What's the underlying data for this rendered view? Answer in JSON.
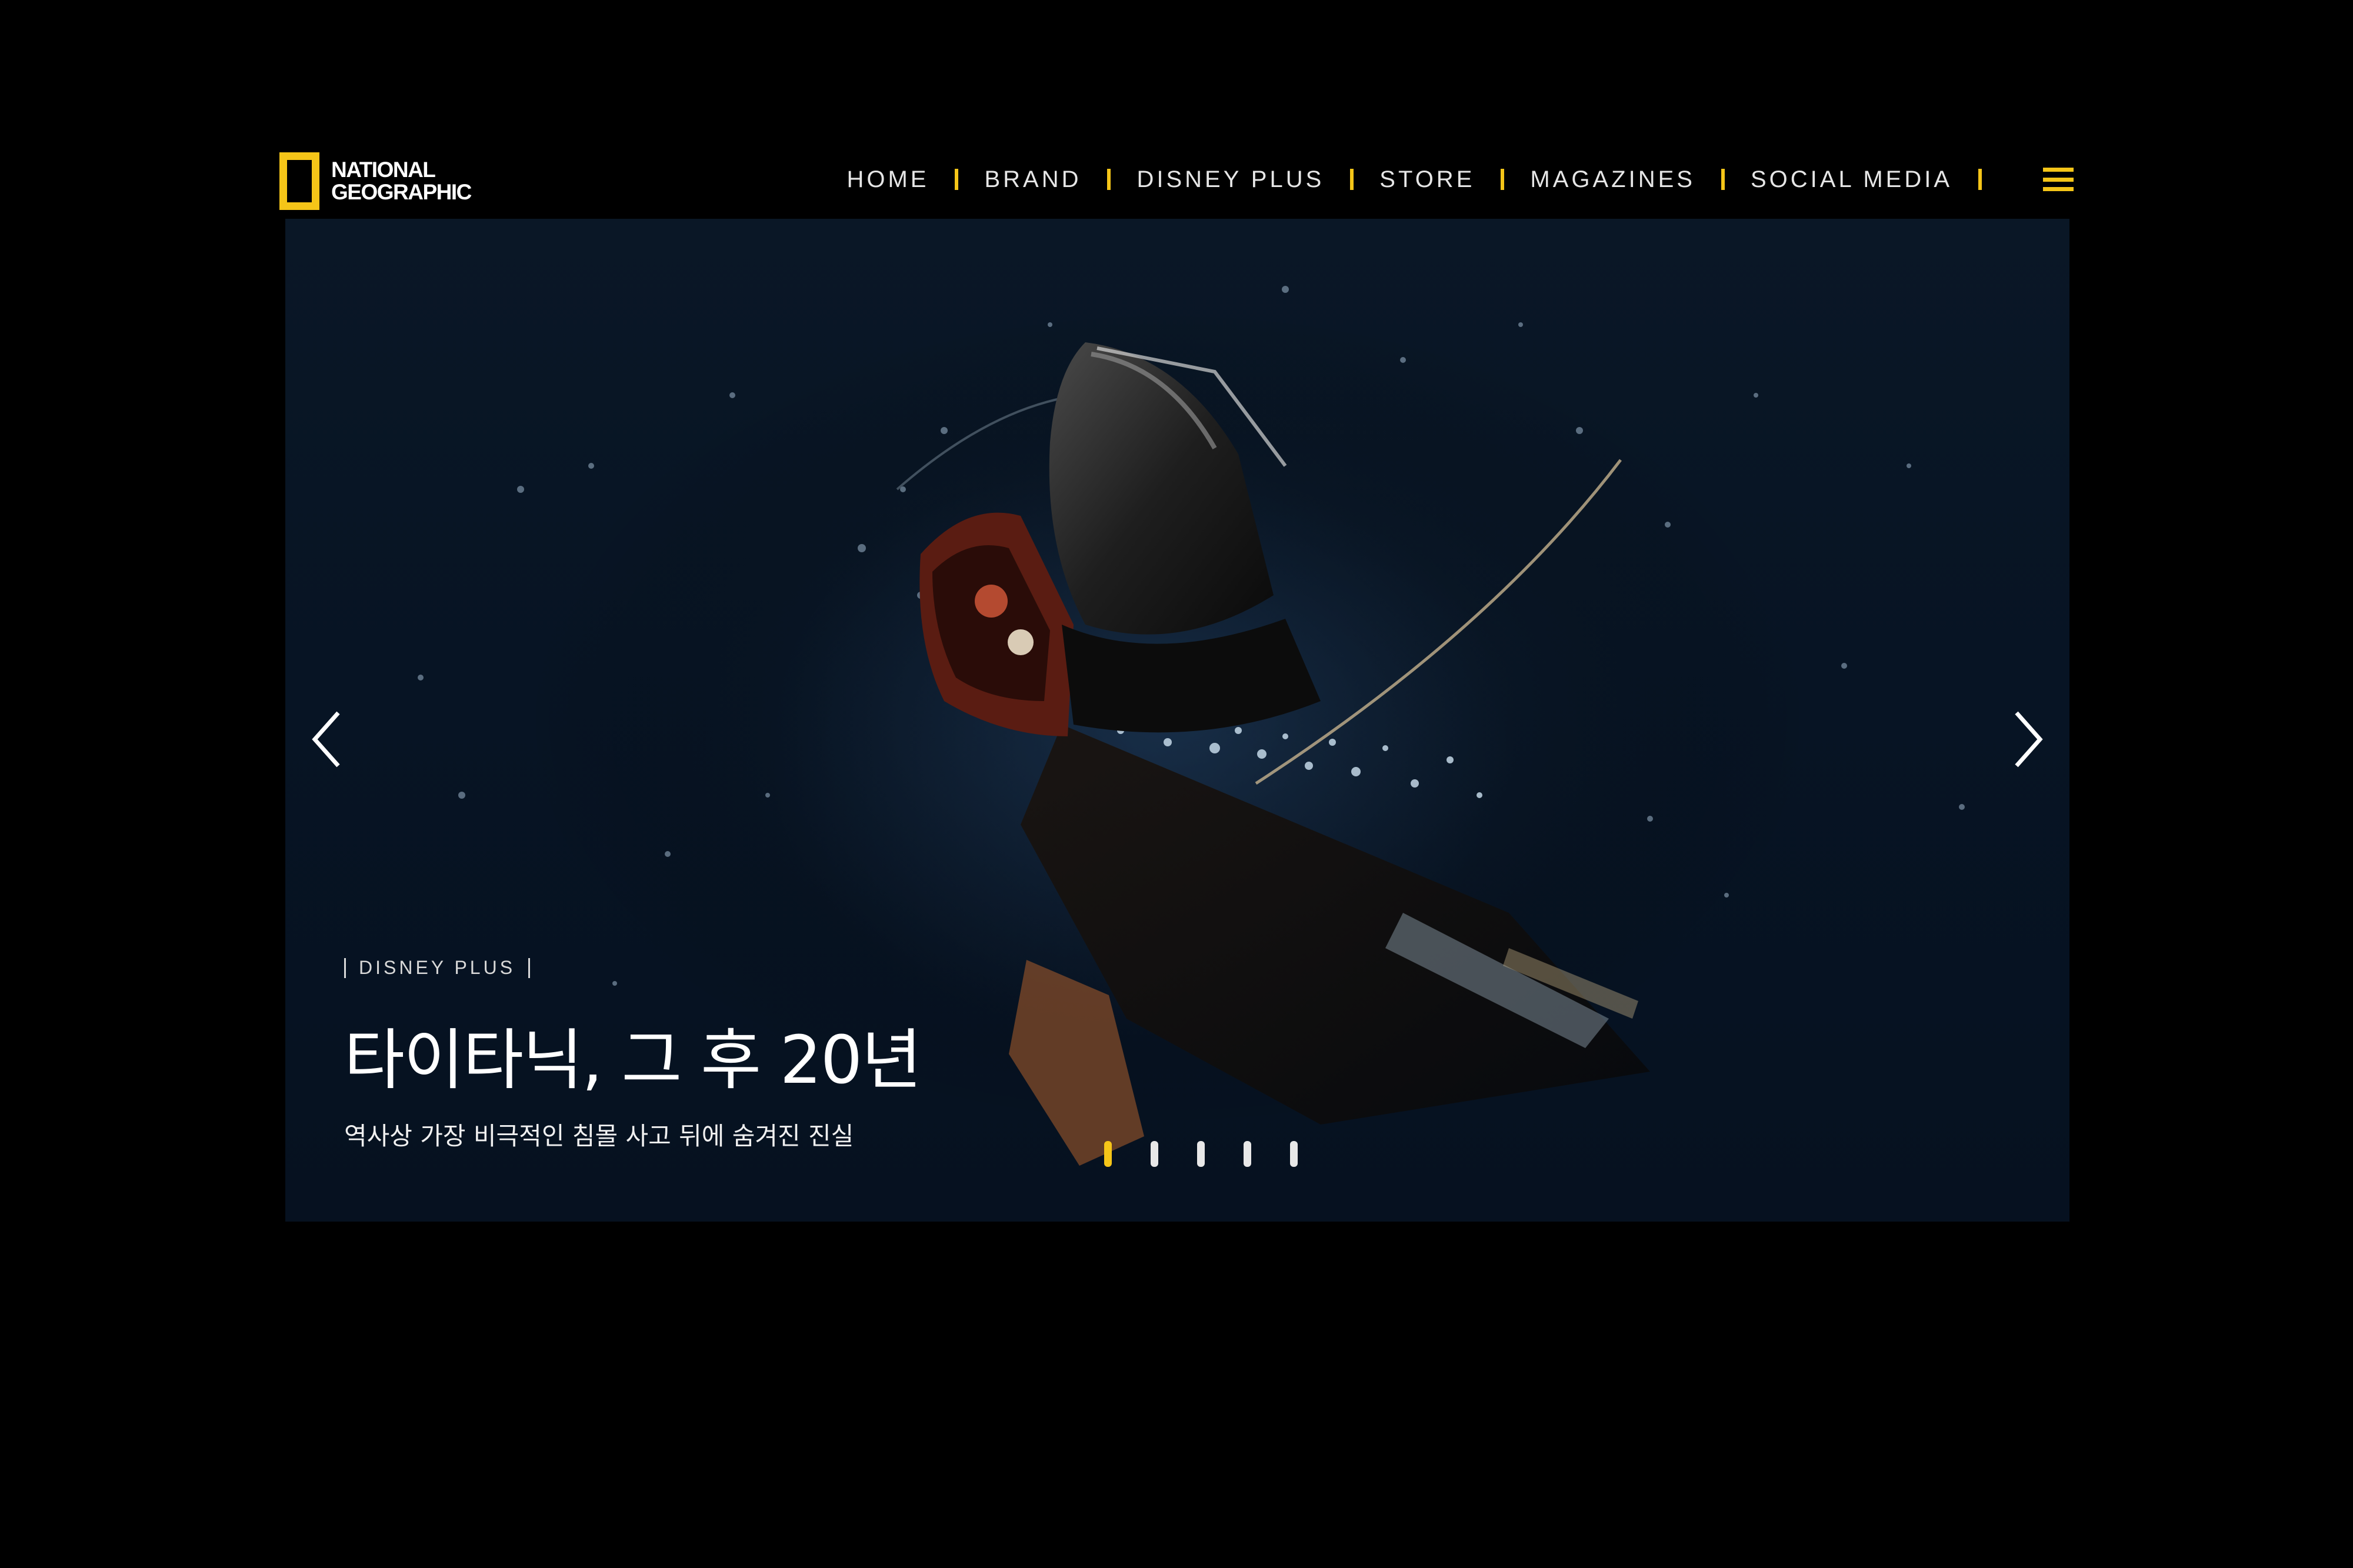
{
  "brand": {
    "logo_line1": "NATIONAL",
    "logo_line2": "GEOGRAPHIC",
    "logo_icon": "yellow-rectangle-icon",
    "accent_color": "#f5c518"
  },
  "nav": {
    "items": [
      {
        "label": "HOME"
      },
      {
        "label": "BRAND"
      },
      {
        "label": "DISNEY PLUS"
      },
      {
        "label": "STORE"
      },
      {
        "label": "MAGAZINES"
      },
      {
        "label": "SOCIAL MEDIA"
      }
    ],
    "menu_icon": "hamburger-menu-icon"
  },
  "hero": {
    "image": "sinking-ship-in-dark-water",
    "category": "DISNEY PLUS",
    "title": "타이타닉, 그 후 20년",
    "subtitle": "역사상 가장 비극적인 침몰 사고 뒤에 숨겨진 진실",
    "prev_icon": "chevron-left-icon",
    "next_icon": "chevron-right-icon",
    "slides_total": 5,
    "active_slide": 1
  }
}
